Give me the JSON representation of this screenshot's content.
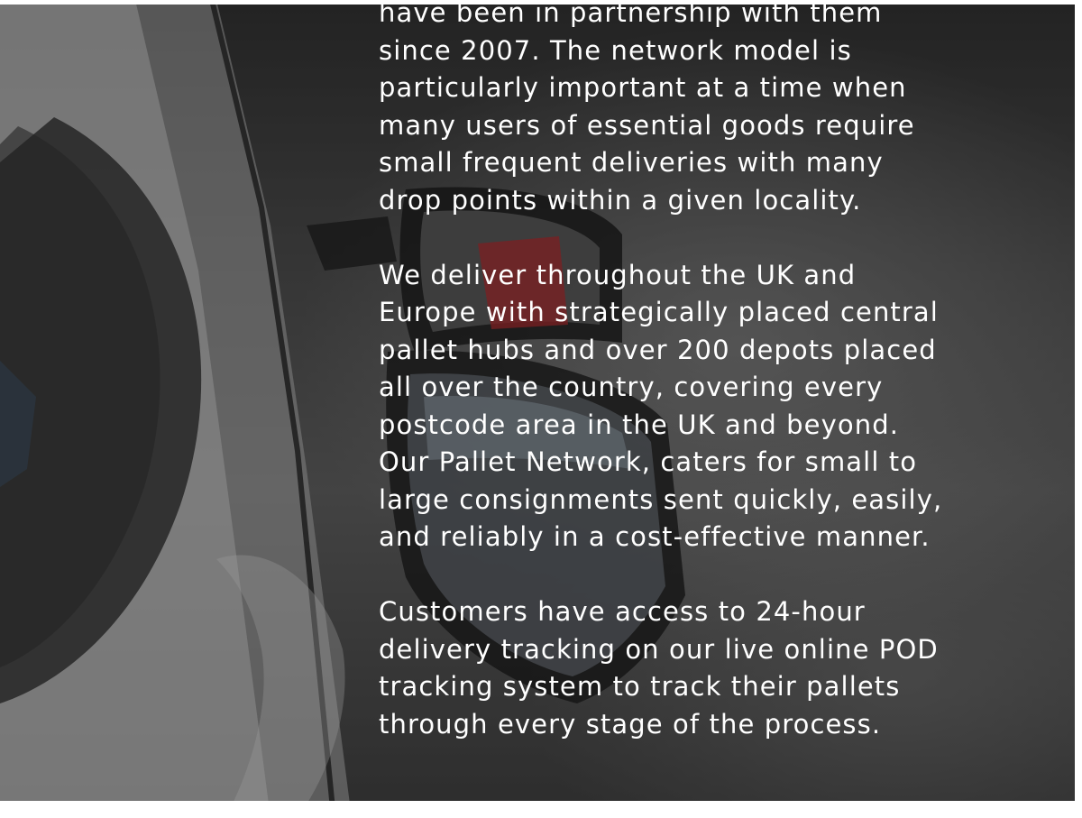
{
  "paragraphs": {
    "p1": "have been in partnership with them since 2007. The network model is particularly important at a time when many users of essential goods require small frequent deliveries with many drop points within a given locality.",
    "p2": "We deliver throughout the UK and Europe with strategically placed central pallet hubs and over 200 depots placed all over the country, covering every postcode area in the UK and beyond.  Our Pallet Network, caters for small to large consignments sent quickly, easily, and reliably in a cost-effective manner.",
    "p3": "Customers have access to 24-hour delivery tracking on our live online POD tracking system to track their pallets through every stage of the process."
  },
  "colors": {
    "text": "#ffffff",
    "overlay": "#1a1a1a",
    "truck_red": "#b3262a"
  },
  "background": {
    "image_subject": "truck-side-mirror-photo"
  }
}
